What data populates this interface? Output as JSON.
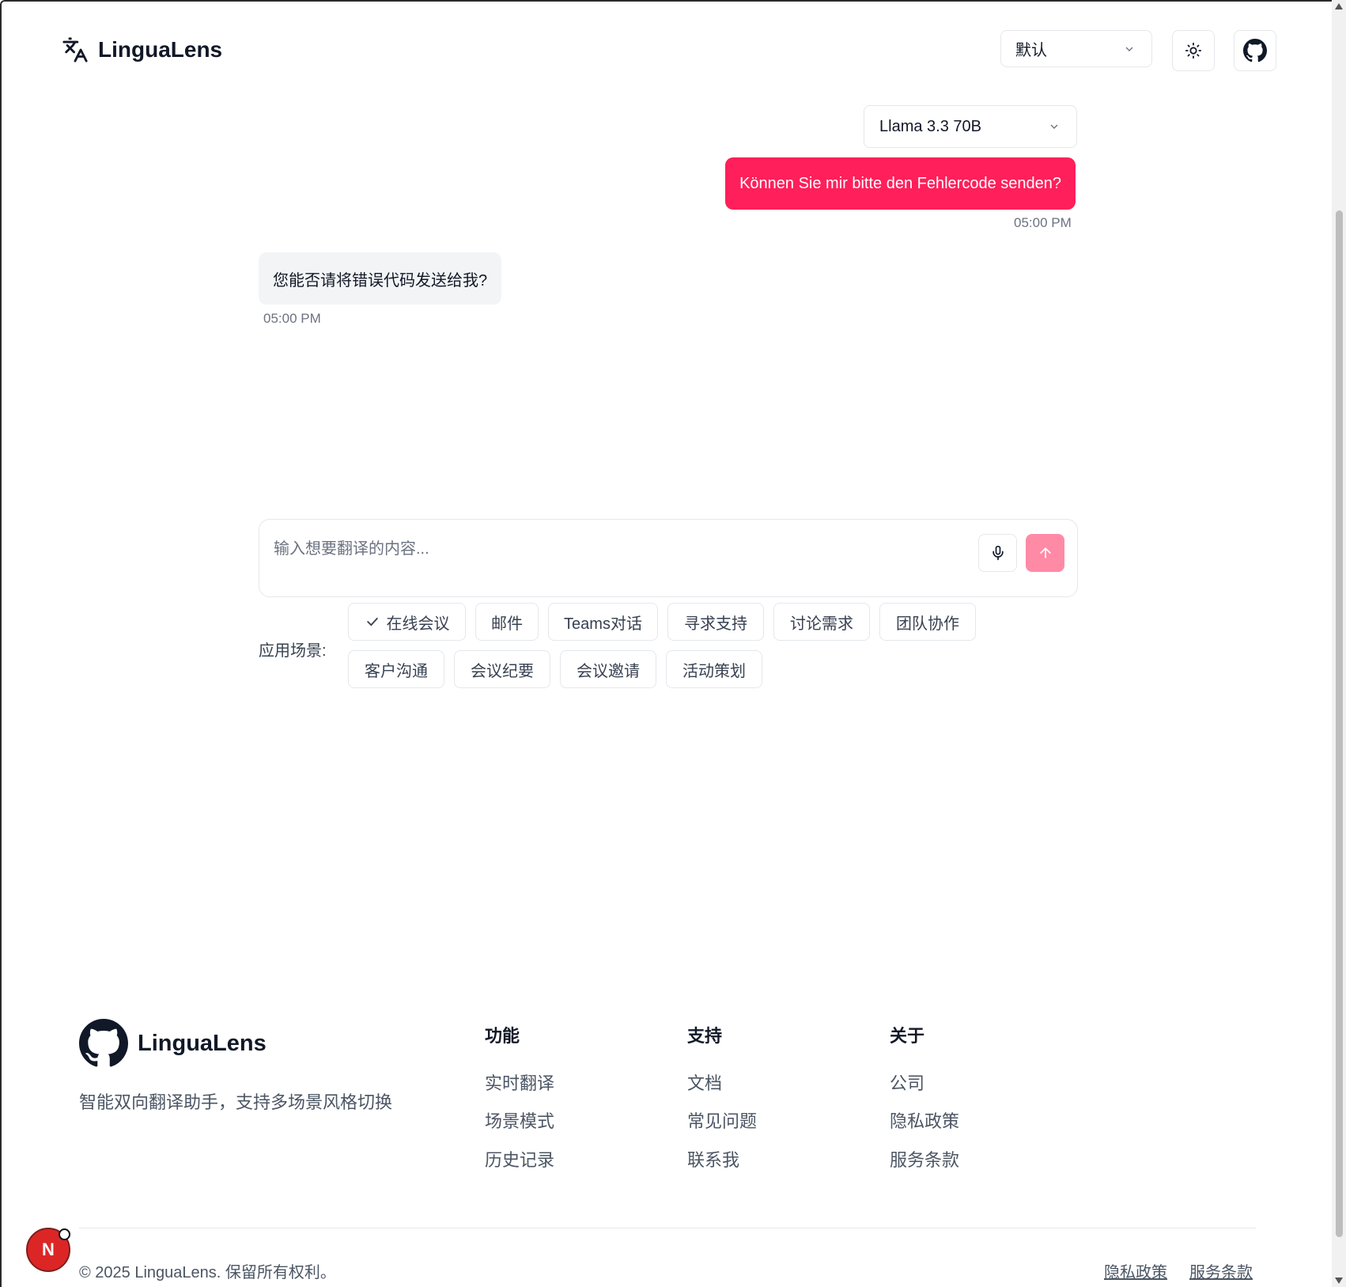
{
  "header": {
    "app_name": "LinguaLens",
    "style_select": "默认"
  },
  "chat": {
    "model_select": "Llama 3.3 70B",
    "messages": [
      {
        "role": "user",
        "text": "Können Sie mir bitte den Fehlercode senden?",
        "time": "05:00 PM"
      },
      {
        "role": "assistant",
        "text": "您能否请将错误代码发送给我?",
        "time": "05:00 PM"
      }
    ]
  },
  "composer": {
    "placeholder": "输入想要翻译的内容..."
  },
  "scenarios": {
    "label": "应用场景:",
    "items": [
      "在线会议",
      "邮件",
      "Teams对话",
      "寻求支持",
      "讨论需求",
      "团队协作",
      "客户沟通",
      "会议纪要",
      "会议邀请",
      "活动策划"
    ],
    "selected": "在线会议"
  },
  "footer": {
    "brand": "LinguaLens",
    "description": "智能双向翻译助手，支持多场景风格切换",
    "columns": [
      {
        "title": "功能",
        "links": [
          "实时翻译",
          "场景模式",
          "历史记录"
        ]
      },
      {
        "title": "支持",
        "links": [
          "文档",
          "常见问题",
          "联系我"
        ]
      },
      {
        "title": "关于",
        "links": [
          "公司",
          "隐私政策",
          "服务条款"
        ]
      }
    ],
    "copyright": "© 2025 LinguaLens. 保留所有权利。",
    "bottom_links": [
      "隐私政策",
      "服务条款"
    ]
  },
  "badge": {
    "letter": "N"
  },
  "colors": {
    "accent": "#ff1f5a",
    "send_button": "#ff8aa6",
    "badge": "#dc2626"
  }
}
